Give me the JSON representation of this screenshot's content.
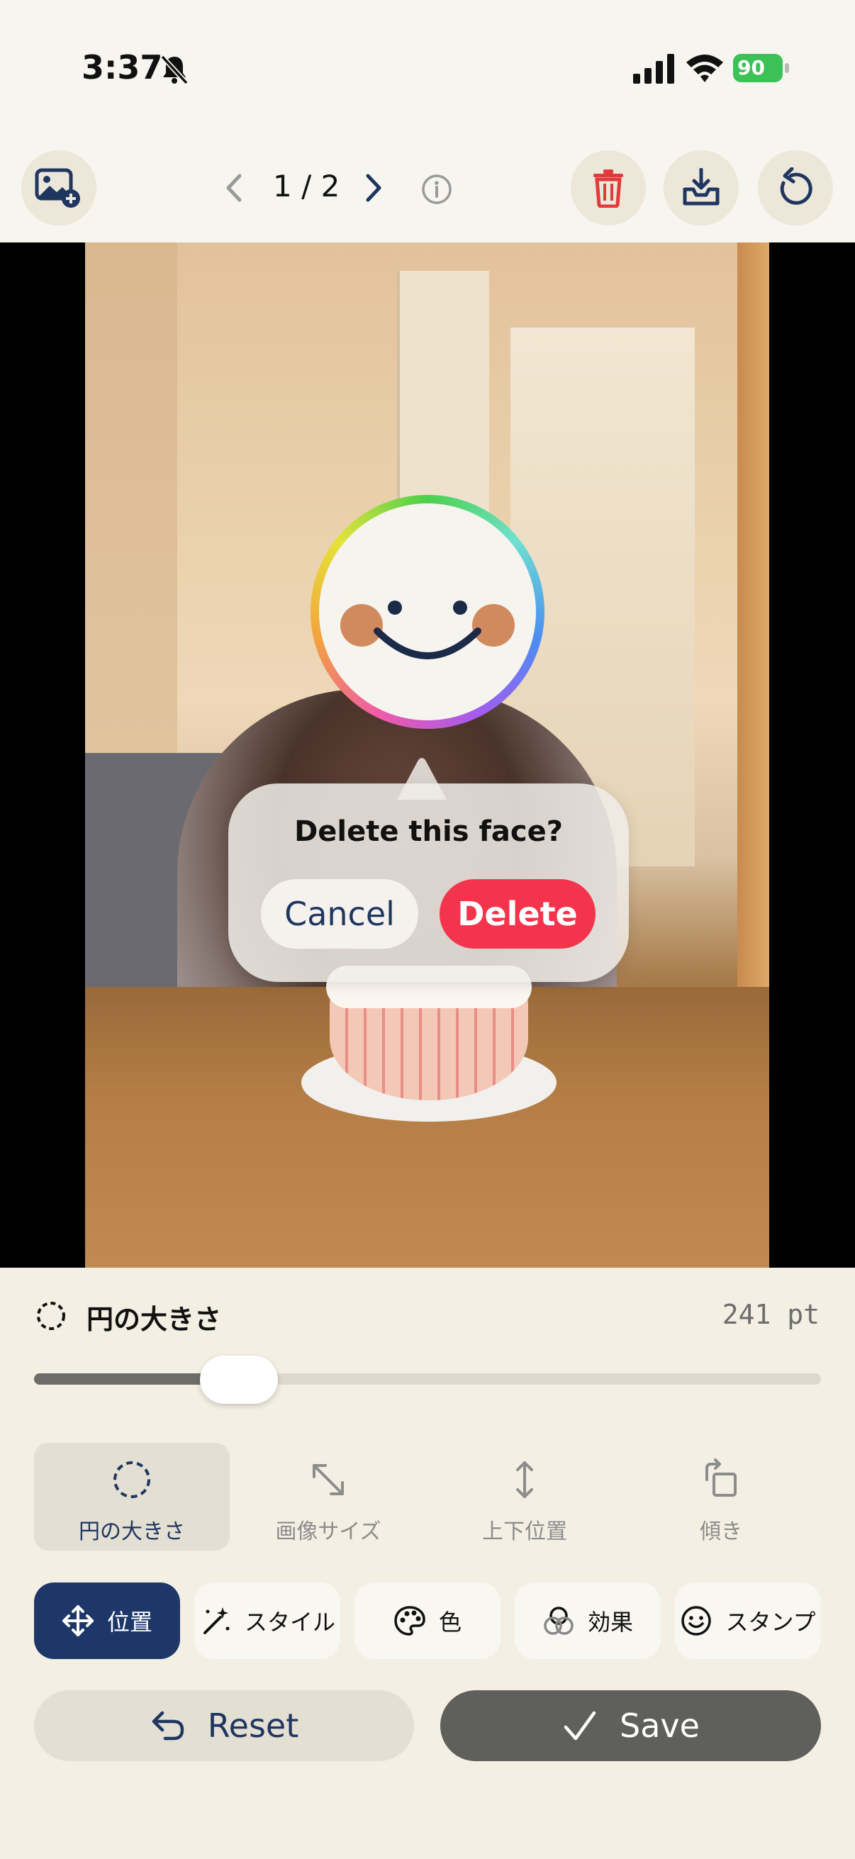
{
  "status_bar": {
    "time": "3:37",
    "battery": "90",
    "icons": [
      "bell-slash-icon",
      "cellular-signal-icon",
      "wifi-icon",
      "battery-icon"
    ]
  },
  "toolbar": {
    "pager_text": "1 / 2",
    "icons": [
      "add-photo-icon",
      "chevron-left-icon",
      "chevron-right-icon",
      "info-icon",
      "trash-icon",
      "download-icon",
      "rotate-icon"
    ]
  },
  "dialog": {
    "title": "Delete this face?",
    "cancel_label": "Cancel",
    "delete_label": "Delete"
  },
  "slider": {
    "label": "円の大きさ",
    "value_text": "241 pt",
    "fraction": 0.26
  },
  "segments": [
    {
      "label": "円の大きさ",
      "icon": "dashed-circle-icon",
      "active": true
    },
    {
      "label": "画像サイズ",
      "icon": "resize-arrows-icon",
      "active": false
    },
    {
      "label": "上下位置",
      "icon": "vertical-arrows-icon",
      "active": false
    },
    {
      "label": "傾き",
      "icon": "rotate-square-icon",
      "active": false
    }
  ],
  "chips": [
    {
      "label": "位置",
      "icon": "move-arrows-icon",
      "active": true
    },
    {
      "label": "スタイル",
      "icon": "magic-wand-icon",
      "active": false
    },
    {
      "label": "色",
      "icon": "palette-icon",
      "active": false
    },
    {
      "label": "効果",
      "icon": "overlapping-circles-icon",
      "active": false
    },
    {
      "label": "スタンプ",
      "icon": "smiley-icon",
      "active": false
    }
  ],
  "actions": {
    "reset_label": "Reset",
    "save_label": "Save"
  },
  "colors": {
    "accent_navy": "#1d3769",
    "delete_red": "#f4344c",
    "battery_green": "#3bc155",
    "panel_bg": "#f3efe3"
  }
}
